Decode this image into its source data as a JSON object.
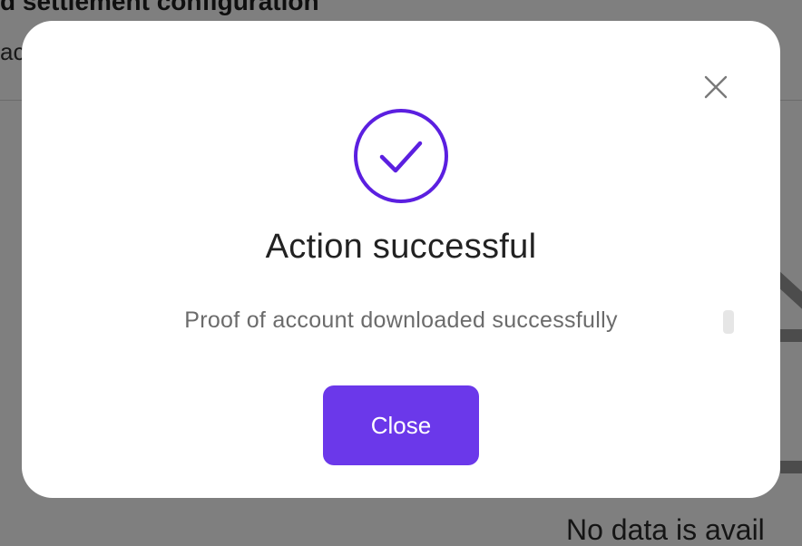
{
  "background": {
    "title": "d settlement configuration",
    "subtext": "ac",
    "empty_state_text": "No data is avail"
  },
  "modal": {
    "title": "Action successful",
    "message": "Proof of account downloaded successfully",
    "close_button_label": "Close",
    "icons": {
      "close": "close-icon",
      "success": "check-circle-icon"
    },
    "colors": {
      "accent": "#6b38ea",
      "success_icon": "#5b1fe0"
    }
  }
}
